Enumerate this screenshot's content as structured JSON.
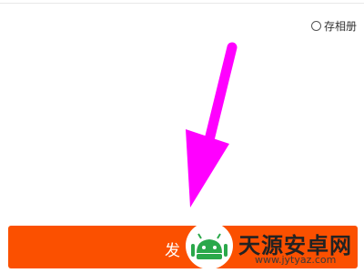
{
  "save_to_album": {
    "label": "存相册",
    "checked": false
  },
  "publish_button": {
    "label_visible": "发"
  },
  "annotation": {
    "arrow_color": "#ff00ff"
  },
  "watermark": {
    "title": "天源安卓网",
    "url": "www.jytyaz.com",
    "logo_color": "#2aa84a"
  },
  "colors": {
    "button_bg": "#fb5000"
  }
}
